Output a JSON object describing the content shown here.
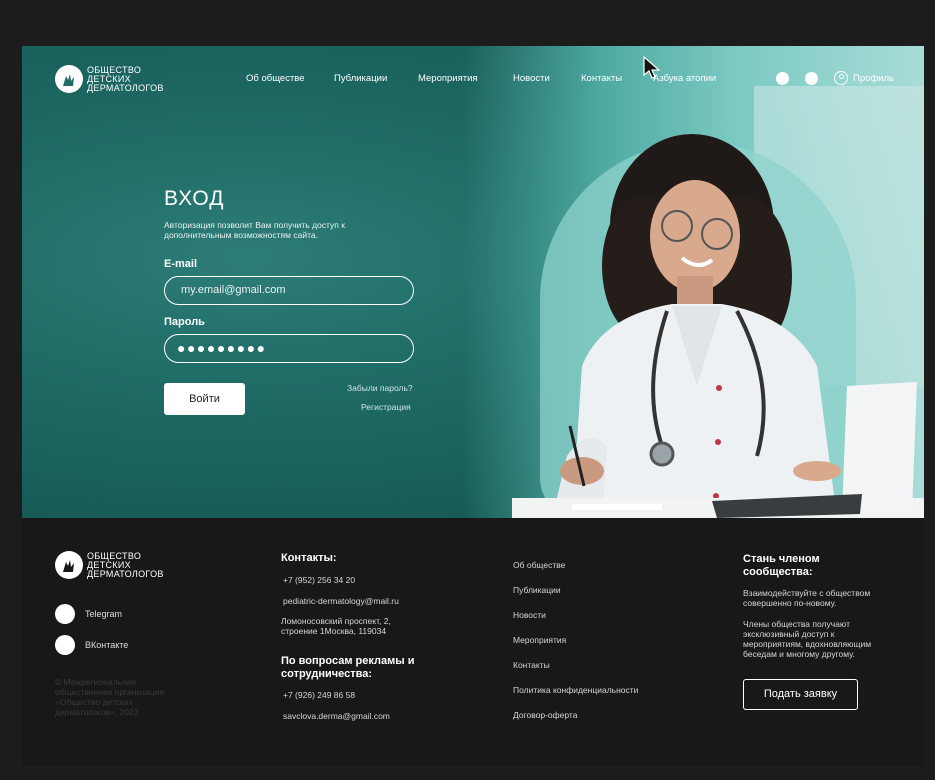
{
  "header": {
    "logo_lines": [
      "ОБЩЕСТВО",
      "ДЕТСКИХ",
      "ДЕРМАТОЛОГОВ"
    ],
    "nav": [
      "Об обществе",
      "Публикации",
      "Мероприятия",
      "Новости",
      "Контакты",
      "Азбука атопии"
    ],
    "profile_label": "Профиль",
    "icons": [
      "theme-toggle-icon",
      "language-toggle-icon",
      "user-icon"
    ]
  },
  "login": {
    "title": "ВХОД",
    "subtitle": "Авторизация позволит Вам получить доступ к дополнительным возможностям сайта.",
    "email_label": "E-mail",
    "email_placeholder": "my.email@gmail.com",
    "password_label": "Пароль",
    "password_value": "●●●●●●●●●",
    "submit_label": "Войти",
    "forgot_label": "Забыли пароль?",
    "register_label": "Регистрация"
  },
  "footer": {
    "logo_lines": [
      "ОБЩЕСТВО",
      "ДЕТСКИХ",
      "ДЕРМАТОЛОГОВ"
    ],
    "socials": [
      "Telegram",
      "ВКонтакте"
    ],
    "copyright": "© Межрегиональная общественная организация «Общество детских дерматологов», 2023",
    "contacts_title": "Контакты:",
    "phone": "+7 (952) 256 34 20",
    "email": "pediatric-dermatology@mail.ru",
    "address": "Ломоносовский проспект, 2, строение 1Москва, 119034",
    "ads_title": "По вопросам рекламы и сотрудничества:",
    "ads_phone": "+7 (926) 249 86 58",
    "ads_email": "savclova.derma@gmail.com",
    "links": [
      "Об обществе",
      "Публикации",
      "Новости",
      "Мероприятия",
      "Контакты",
      "Политика конфиденциальности",
      "Договор-оферта"
    ],
    "join_title": "Стань членом сообщества:",
    "join_text_1": "Взаимодействуйте с обществом совершенно по-новому.",
    "join_text_2": "Члены общества получают эксклюзивный доступ к мероприятиям, вдохновляющим беседам и многому другому.",
    "apply_label": "Подать заявку"
  }
}
